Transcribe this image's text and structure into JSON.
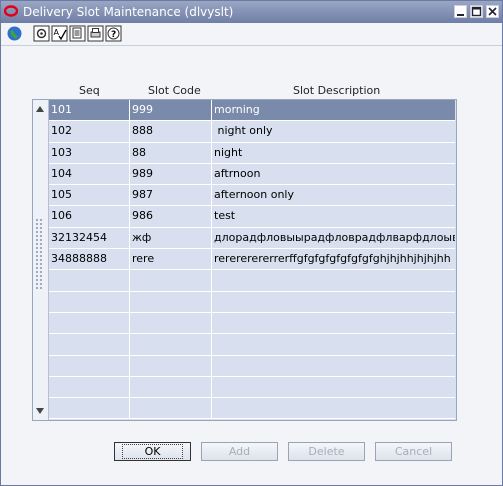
{
  "window": {
    "title": "Delivery Slot Maintenance (dlvyslt)"
  },
  "toolbar": {
    "icons": [
      "globe-icon",
      "tool-icon",
      "spell-check-icon",
      "document-icon",
      "print-icon",
      "help-icon"
    ]
  },
  "table": {
    "headers": [
      "Seq",
      "Slot Code",
      "Slot Description"
    ],
    "rows": [
      {
        "seq": "101",
        "code": "999",
        "desc": "morning"
      },
      {
        "seq": "102",
        "code": "888",
        "desc": " night only"
      },
      {
        "seq": "103",
        "code": "88",
        "desc": "night"
      },
      {
        "seq": "104",
        "code": "989",
        "desc": "aftrnoon"
      },
      {
        "seq": "105",
        "code": "987",
        "desc": "afternoon only"
      },
      {
        "seq": "106",
        "code": "986",
        "desc": "test"
      },
      {
        "seq": "32132454",
        "code": "жф",
        "desc": "длорадфловыырадфловрадфлварфдлоыврадфо"
      },
      {
        "seq": "34888888",
        "code": "rere",
        "desc": "rerererererrerffgfgfgfgfgfgfgfghjhjhhjhjhjhh"
      }
    ],
    "selected_index": 0,
    "empty_rows": 7
  },
  "buttons": {
    "ok": "OK",
    "add": "Add",
    "delete": "Delete",
    "cancel": "Cancel"
  },
  "colors": {
    "title_bar": "#7f8cb0",
    "selected_row": "#7a8aab",
    "row_bg": "#d8e0f0"
  }
}
